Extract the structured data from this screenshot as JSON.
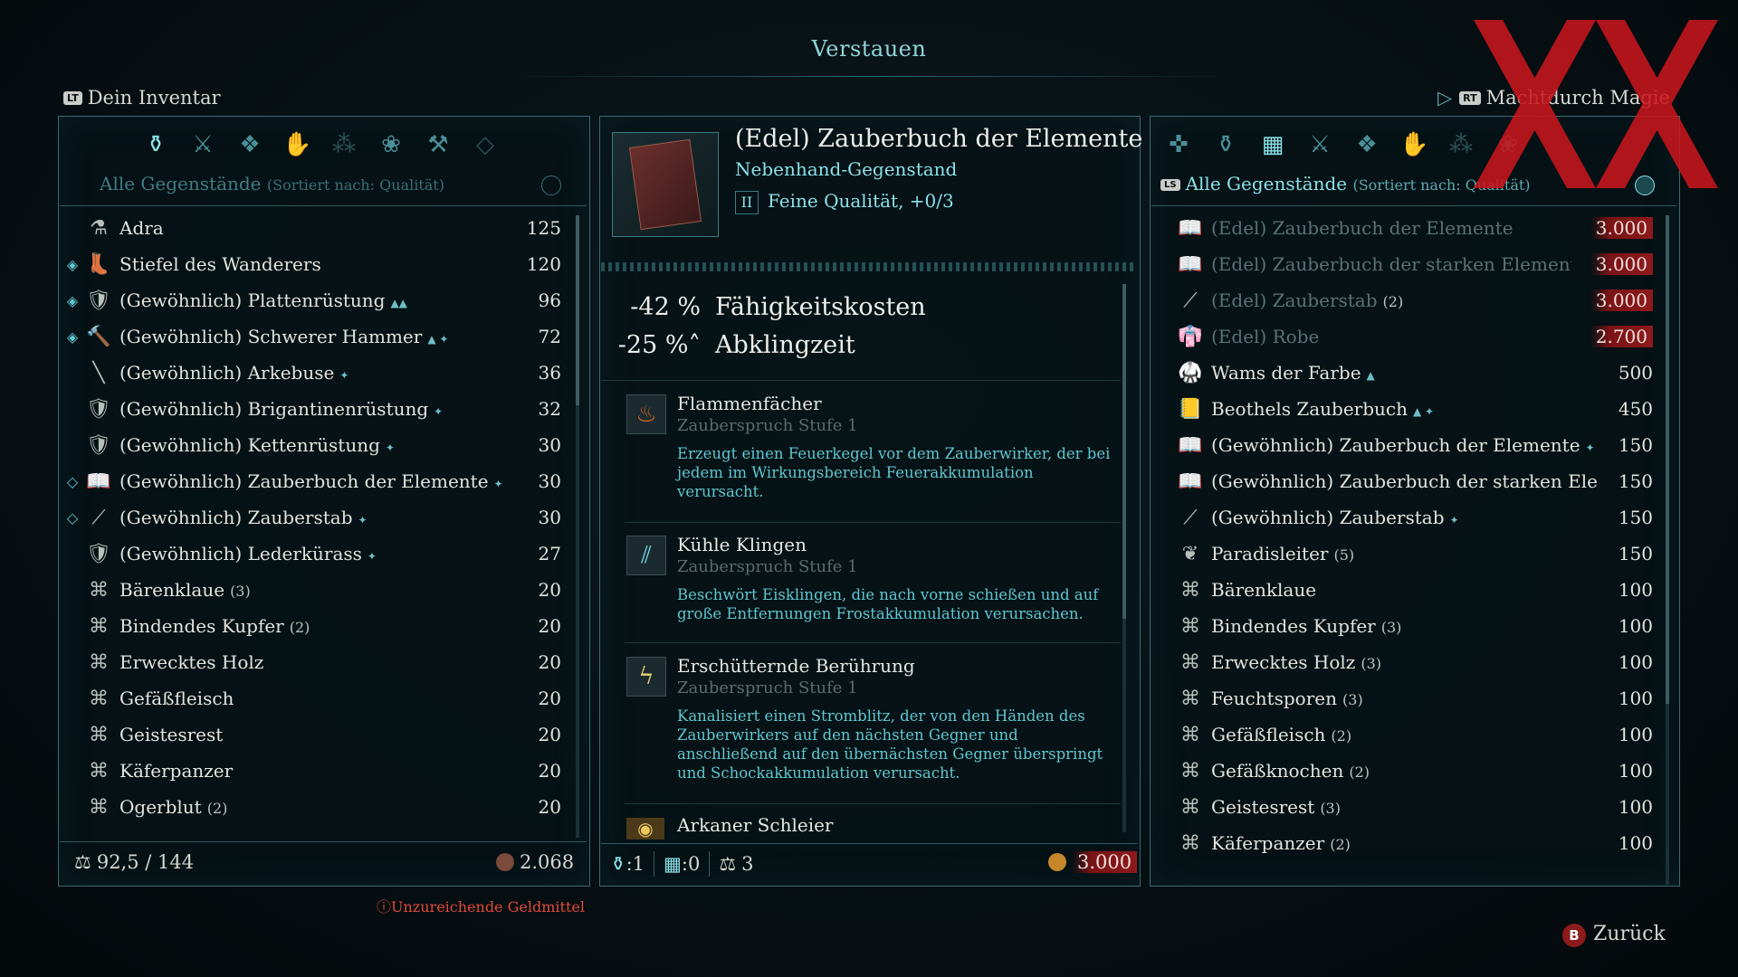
{
  "title": "Verstauen",
  "left": {
    "header_tag": "LT",
    "header": "Dein Inventar",
    "filter_main": "Alle Gegenstände",
    "filter_sort": "(Sortiert nach: Qualität)",
    "items": [
      {
        "icon": "adra-icon",
        "glyph": "⚗",
        "name": "Adra",
        "qty": "",
        "tags": "",
        "value": "125",
        "mark": ""
      },
      {
        "icon": "boots-icon",
        "glyph": "👢",
        "name": "Stiefel des Wanderers",
        "qty": "",
        "tags": "",
        "value": "120",
        "mark": "◈"
      },
      {
        "icon": "plate-armor-icon",
        "glyph": "🛡",
        "name": "(Gewöhnlich) Plattenrüstung",
        "qty": "",
        "tags": "▲▲",
        "value": "96",
        "mark": "◈"
      },
      {
        "icon": "hammer-icon",
        "glyph": "🔨",
        "name": "(Gewöhnlich) Schwerer Hammer",
        "qty": "",
        "tags": "▲ ✦",
        "value": "72",
        "mark": "◈"
      },
      {
        "icon": "arquebus-icon",
        "glyph": "╲",
        "name": "(Gewöhnlich) Arkebuse",
        "qty": "",
        "tags": "✦",
        "value": "36",
        "mark": ""
      },
      {
        "icon": "brigandine-icon",
        "glyph": "🛡",
        "name": "(Gewöhnlich) Brigantinenrüstung",
        "qty": "",
        "tags": "✦",
        "value": "32",
        "mark": ""
      },
      {
        "icon": "chainmail-icon",
        "glyph": "🛡",
        "name": "(Gewöhnlich) Kettenrüstung",
        "qty": "",
        "tags": "✦",
        "value": "30",
        "mark": ""
      },
      {
        "icon": "spellbook-icon",
        "glyph": "📖",
        "name": "(Gewöhnlich) Zauberbuch der Elemente",
        "qty": "",
        "tags": "✦",
        "value": "30",
        "mark": "◇"
      },
      {
        "icon": "wand-icon",
        "glyph": "⟋",
        "name": "(Gewöhnlich) Zauberstab",
        "qty": "",
        "tags": "✦",
        "value": "30",
        "mark": "◇"
      },
      {
        "icon": "leather-cuirass-icon",
        "glyph": "🛡",
        "name": "(Gewöhnlich) Lederkürass",
        "qty": "",
        "tags": "✦",
        "value": "27",
        "mark": ""
      },
      {
        "icon": "ingredient-icon",
        "glyph": "⌘",
        "name": "Bärenklaue",
        "qty": "(3)",
        "tags": "",
        "value": "20",
        "mark": ""
      },
      {
        "icon": "ingredient-icon",
        "glyph": "⌘",
        "name": "Bindendes Kupfer",
        "qty": "(2)",
        "tags": "",
        "value": "20",
        "mark": ""
      },
      {
        "icon": "ingredient-icon",
        "glyph": "⌘",
        "name": "Erwecktes Holz",
        "qty": "",
        "tags": "",
        "value": "20",
        "mark": ""
      },
      {
        "icon": "ingredient-icon",
        "glyph": "⌘",
        "name": "Gefäßfleisch",
        "qty": "",
        "tags": "",
        "value": "20",
        "mark": ""
      },
      {
        "icon": "ingredient-icon",
        "glyph": "⌘",
        "name": "Geistesrest",
        "qty": "",
        "tags": "",
        "value": "20",
        "mark": ""
      },
      {
        "icon": "ingredient-icon",
        "glyph": "⌘",
        "name": "Käferpanzer",
        "qty": "",
        "tags": "",
        "value": "20",
        "mark": ""
      },
      {
        "icon": "ingredient-icon",
        "glyph": "⌘",
        "name": "Ogerblut",
        "qty": "(2)",
        "tags": "",
        "value": "20",
        "mark": ""
      }
    ],
    "weight": "92,5 / 144",
    "money": "2.068",
    "warning": "Unzureichende Geldmittel"
  },
  "detail": {
    "title": "(Edel) Zauberbuch der Elemente",
    "subtitle": "Nebenhand-Gegenstand",
    "quality_tier": "II",
    "quality": "Feine Qualität, +0/3",
    "stats": [
      {
        "value": "-42 %",
        "label": "Fähigkeitskosten"
      },
      {
        "value": "-25 %˄",
        "label": "Abklingzeit"
      }
    ],
    "spells": [
      {
        "name": "Flammenfächer",
        "level": "Zauberspruch Stufe 1",
        "desc": "Erzeugt einen Feuerkegel vor dem Zauberwirker, der bei jedem im Wirkungsbereich Feuerakkumulation verursacht."
      },
      {
        "name": "Kühle Klingen",
        "level": "Zauberspruch Stufe 1",
        "desc": "Beschwört Eisklingen, die nach vorne schießen und auf große Entfernungen Frostakkumulation verursachen."
      },
      {
        "name": "Erschütternde Berührung",
        "level": "Zauberspruch Stufe 1",
        "desc": "Kanalisiert einen Stromblitz, der von den Händen des Zauberwirkers auf den nächsten Gegner und anschließend auf den übernächsten Gegner überspringt und Schockakkumulation verursacht."
      },
      {
        "name": "Arkaner Schleier",
        "level": "",
        "desc": ""
      }
    ],
    "footer": {
      "bag": ":1",
      "chest": ":0",
      "weight": "3",
      "price": "3.000"
    }
  },
  "right": {
    "header_tag": "RT",
    "header": "Machtdurch Magie",
    "ls_tag": "LS",
    "filter_main": "Alle Gegenstände",
    "filter_sort": "(Sortiert nach: Qualität)",
    "items": [
      {
        "icon": "spellbook-icon",
        "glyph": "📖",
        "name": "(Edel) Zauberbuch der Elemente",
        "qty": "",
        "tags": "",
        "value": "3.000",
        "faded": true,
        "red": true
      },
      {
        "icon": "spellbook-icon",
        "glyph": "📖",
        "name": "(Edel) Zauberbuch der starken Elemente",
        "qty": "",
        "tags": "",
        "value": "3.000",
        "faded": true,
        "red": true
      },
      {
        "icon": "wand-icon",
        "glyph": "⟋",
        "name": "(Edel) Zauberstab",
        "qty": "(2)",
        "tags": "",
        "value": "3.000",
        "faded": true,
        "red": true
      },
      {
        "icon": "robe-icon",
        "glyph": "👘",
        "name": "(Edel) Robe",
        "qty": "",
        "tags": "",
        "value": "2.700",
        "faded": true,
        "red": true
      },
      {
        "icon": "doublet-icon",
        "glyph": "🥋",
        "name": "Wams der Farbe",
        "qty": "",
        "tags": "▲",
        "value": "500",
        "faded": false,
        "red": false
      },
      {
        "icon": "spellbook-icon",
        "glyph": "📒",
        "name": "Beothels Zauberbuch",
        "qty": "",
        "tags": "▲ ✦",
        "value": "450",
        "faded": false,
        "red": false
      },
      {
        "icon": "spellbook-icon",
        "glyph": "📖",
        "name": "(Gewöhnlich) Zauberbuch der Elemente",
        "qty": "",
        "tags": "✦",
        "value": "150",
        "faded": false,
        "red": false
      },
      {
        "icon": "spellbook-icon",
        "glyph": "📖",
        "name": "(Gewöhnlich) Zauberbuch der starken Ele...",
        "qty": "",
        "tags": "✦",
        "value": "150",
        "faded": false,
        "red": false
      },
      {
        "icon": "wand-icon",
        "glyph": "⟋",
        "name": "(Gewöhnlich) Zauberstab",
        "qty": "",
        "tags": "✦",
        "value": "150",
        "faded": false,
        "red": false
      },
      {
        "icon": "herb-icon",
        "glyph": "❦",
        "name": "Paradisleiter",
        "qty": "(5)",
        "tags": "",
        "value": "150",
        "faded": false,
        "red": false
      },
      {
        "icon": "ingredient-icon",
        "glyph": "⌘",
        "name": "Bärenklaue",
        "qty": "",
        "tags": "",
        "value": "100",
        "faded": false,
        "red": false
      },
      {
        "icon": "ingredient-icon",
        "glyph": "⌘",
        "name": "Bindendes Kupfer",
        "qty": "(3)",
        "tags": "",
        "value": "100",
        "faded": false,
        "red": false
      },
      {
        "icon": "ingredient-icon",
        "glyph": "⌘",
        "name": "Erwecktes Holz",
        "qty": "(3)",
        "tags": "",
        "value": "100",
        "faded": false,
        "red": false
      },
      {
        "icon": "ingredient-icon",
        "glyph": "⌘",
        "name": "Feuchtsporen",
        "qty": "(3)",
        "tags": "",
        "value": "100",
        "faded": false,
        "red": false
      },
      {
        "icon": "ingredient-icon",
        "glyph": "⌘",
        "name": "Gefäßfleisch",
        "qty": "(2)",
        "tags": "",
        "value": "100",
        "faded": false,
        "red": false
      },
      {
        "icon": "ingredient-icon",
        "glyph": "⌘",
        "name": "Gefäßknochen",
        "qty": "(2)",
        "tags": "",
        "value": "100",
        "faded": false,
        "red": false
      },
      {
        "icon": "ingredient-icon",
        "glyph": "⌘",
        "name": "Geistesrest",
        "qty": "(3)",
        "tags": "",
        "value": "100",
        "faded": false,
        "red": false
      },
      {
        "icon": "ingredient-icon",
        "glyph": "⌘",
        "name": "Käferpanzer",
        "qty": "(2)",
        "tags": "",
        "value": "100",
        "faded": false,
        "red": false
      }
    ]
  },
  "back_button": "B",
  "back_label": "Zurück",
  "colors": {
    "accent": "#8be2e8",
    "warning": "#e04a3a",
    "price_bg": "#8d1a1c"
  }
}
